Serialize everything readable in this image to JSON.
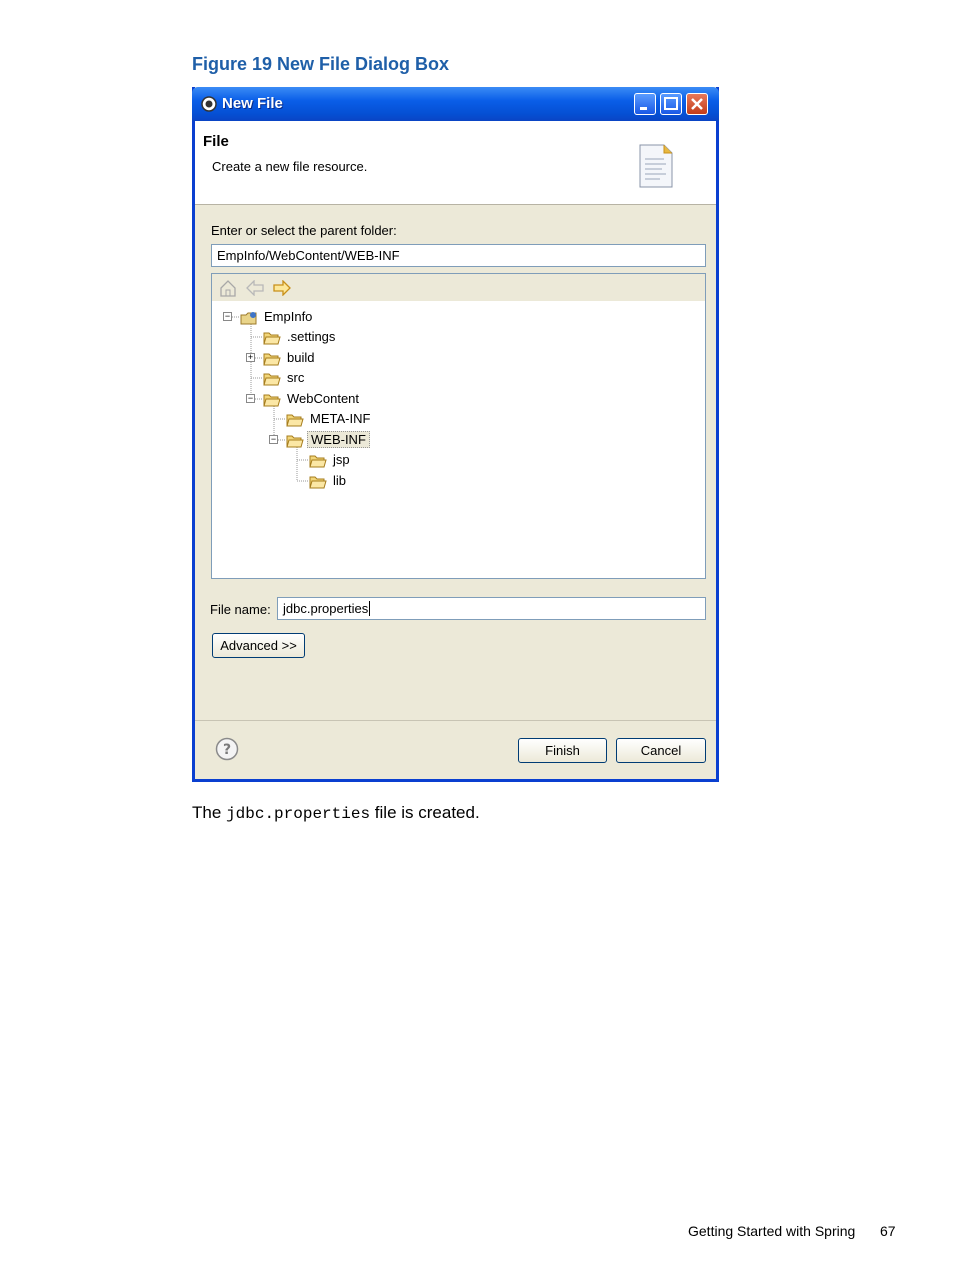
{
  "caption": "Figure 19 New File Dialog Box",
  "dialog": {
    "title": "New File",
    "banner_title": "File",
    "banner_subtitle": "Create a new file resource.",
    "parent_folder_label": "Enter or select the parent folder:",
    "parent_folder_value": "EmpInfo/WebContent/WEB-INF",
    "tree": [
      {
        "label": "EmpInfo",
        "expander": "⊟"
      },
      {
        "label": ".settings",
        "expander": ""
      },
      {
        "label": "build",
        "expander": "⊞"
      },
      {
        "label": "src",
        "expander": ""
      },
      {
        "label": "WebContent",
        "expander": "⊟"
      },
      {
        "label": "META-INF",
        "expander": ""
      },
      {
        "label": "WEB-INF",
        "expander": "⊟"
      },
      {
        "label": "jsp",
        "expander": ""
      },
      {
        "label": "lib",
        "expander": ""
      }
    ],
    "file_name_label": "File name:",
    "file_name_value": "jdbc.properties",
    "advanced_label": "Advanced >>",
    "finish_label": "Finish",
    "cancel_label": "Cancel"
  },
  "body": {
    "before": "The",
    "code": "jdbc.properties",
    "after": "file is created."
  },
  "footer": {
    "section": "Getting Started with Spring",
    "page": "67"
  },
  "colors": {
    "caption": "#1f5fa8",
    "titlebar": "#0a5ee8",
    "dialog_bg": "#ece9d8"
  }
}
